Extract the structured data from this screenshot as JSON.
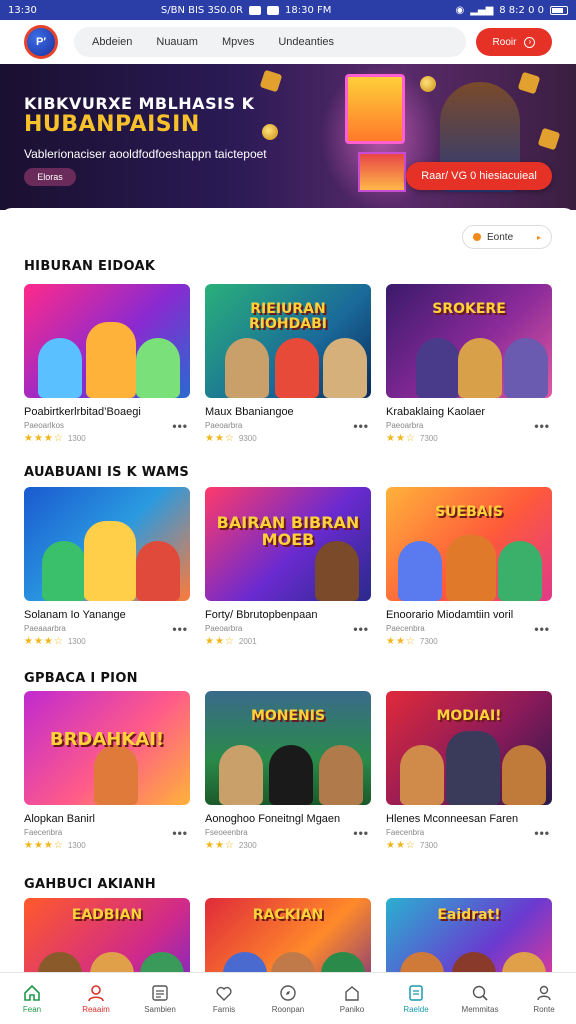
{
  "status_bar": {
    "time": "13:30",
    "center_text_1": "S/BN BIS 3S0.0R",
    "center_text_2": "18:30 FM",
    "right_text": "8 8:2 0 0"
  },
  "header": {
    "logo_text": "P′",
    "nav_items": [
      "Abdeien",
      "Nuauam",
      "Mpves",
      "Undeanties"
    ],
    "cta_label": "Rooir"
  },
  "hero": {
    "title_line1": "KIBKVURXE MBLHASIS K",
    "title_line2": "HUBANPAISIN",
    "subtitle": "Vablerionaciser aooldfodfoeshappn taictepoet",
    "tag": "Eloras",
    "cta_label": "Raar/ VG 0 hiesiacuieal"
  },
  "filter": {
    "label": "Eonte"
  },
  "sections": [
    {
      "title": "HIBURAN EIDOAK",
      "cards": [
        {
          "title": "Poabirtkerlrbitad’Boaegi",
          "sub": "Paeoarlkos",
          "rating_text": "1300",
          "image_text": ""
        },
        {
          "title": "Maux Bbaniangoe",
          "sub": "Paeoarbra",
          "rating_text": "9300",
          "image_text": "RIEIURAN RIOHDABI"
        },
        {
          "title": "Krabaklaing Kaolaer",
          "sub": "Paeoarbra",
          "rating_text": "7300",
          "image_text": "SROKERE"
        }
      ]
    },
    {
      "title": "AUABUANI IS K WAMS",
      "cards": [
        {
          "title": "Solanam Io Yanange",
          "sub": "Paeaaarbra",
          "rating_text": "1300",
          "image_text": ""
        },
        {
          "title": "Forty/ Bbrutopbenpaan",
          "sub": "Paeoarbra",
          "rating_text": "2001",
          "image_text": "BAIRAN BIBRAN MOEB"
        },
        {
          "title": "Enoorario Miodamtiin voril",
          "sub": "Paecenbra",
          "rating_text": "7300",
          "image_text": "SUEBAIS"
        }
      ]
    },
    {
      "title": "GPBACA I PION",
      "cards": [
        {
          "title": "Alopkan Banirl",
          "sub": "Faecenbra",
          "rating_text": "1300",
          "image_text": "BRDAHKAI!"
        },
        {
          "title": "Aonoghoo Foneitngl Mgaen",
          "sub": "Fseoeenbra",
          "rating_text": "2300",
          "image_text": "MONENIS"
        },
        {
          "title": "Hlenes Mconneesan Faren",
          "sub": "Faecenbra",
          "rating_text": "7300",
          "image_text": "MODIAI!"
        }
      ]
    },
    {
      "title": "GAHBUCI AKIANH",
      "cards": [
        {
          "title": "",
          "sub": "",
          "rating_text": "",
          "image_text": "EADBIAN"
        },
        {
          "title": "",
          "sub": "",
          "rating_text": "",
          "image_text": "RACKIAN"
        },
        {
          "title": "",
          "sub": "",
          "rating_text": "",
          "image_text": "Eaidrat!"
        }
      ]
    }
  ],
  "bottom_nav": [
    {
      "label": "Fean",
      "icon": "home-icon"
    },
    {
      "label": "Reaaim",
      "icon": "user-icon"
    },
    {
      "label": "Sambien",
      "icon": "list-icon"
    },
    {
      "label": "Farnis",
      "icon": "heart-icon"
    },
    {
      "label": "Roonpan",
      "icon": "compass-icon"
    },
    {
      "label": "Paniko",
      "icon": "house-outline-icon"
    },
    {
      "label": "Raelde",
      "icon": "document-icon"
    },
    {
      "label": "Memmitas",
      "icon": "search-icon"
    },
    {
      "label": "Ronte",
      "icon": "profile-icon"
    }
  ],
  "colors": {
    "accent_red": "#e63226",
    "status_blue": "#2b3ea8",
    "star_gold": "#f2b61b",
    "active_green": "#1e9a4a"
  }
}
